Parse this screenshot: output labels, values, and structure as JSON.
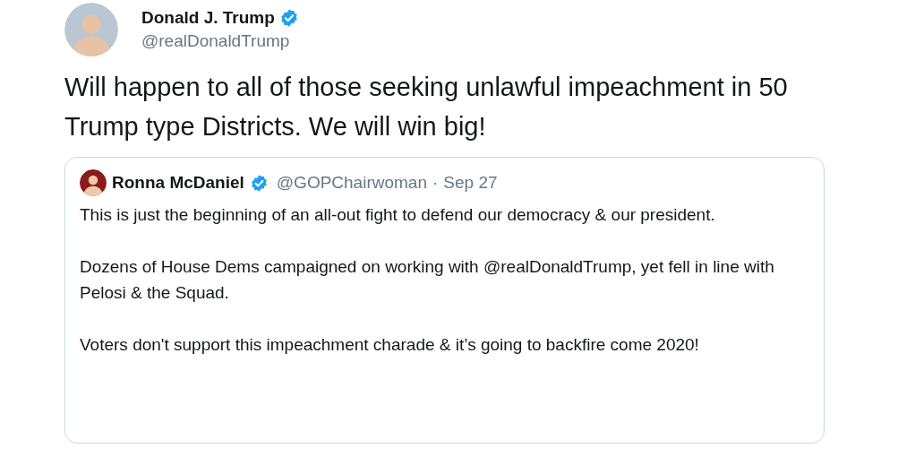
{
  "tweet": {
    "author": {
      "name": "Donald J. Trump",
      "handle": "@realDonaldTrump",
      "verified": true
    },
    "text": "Will happen to all of those seeking unlawful impeachment in 50 Trump type Districts. We will win big!",
    "quoted_tweet": {
      "author": {
        "name": "Ronna McDaniel",
        "handle": "@GOPChairwoman",
        "verified": true
      },
      "separator": "·",
      "date": "Sep 27",
      "paragraphs": [
        "This is just the beginning of an all-out fight to defend our democracy & our president.",
        "Dozens of House Dems campaigned on working with @realDonaldTrump, yet fell in line with Pelosi & the Squad.",
        "Voters don't support this impeachment charade & it’s going to backfire come 2020!"
      ]
    }
  }
}
